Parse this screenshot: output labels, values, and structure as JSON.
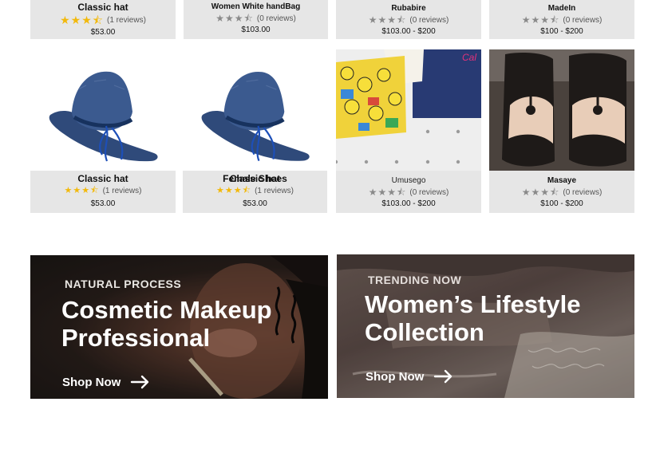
{
  "colors": {
    "card_bg": "#e6e6e6",
    "star_gold": "#f2b90c",
    "star_gray": "#8a8a8a",
    "text": "#111111"
  },
  "top_row": [
    {
      "name": "Classic hat",
      "reviews": "(1 reviews)",
      "price": "$53.00",
      "rating": 3.5,
      "star_color": "gold"
    },
    {
      "name": "Women White handBag",
      "reviews": "(0 reviews)",
      "price": "$103.00",
      "rating": 3.5,
      "star_color": "gray"
    },
    {
      "name": "Rubabire",
      "reviews": "(0 reviews)",
      "price": "$103.00 - $200",
      "rating": 3.5,
      "star_color": "gray"
    },
    {
      "name": "MadeIn",
      "reviews": "(0 reviews)",
      "price": "$100 - $200",
      "rating": 3.5,
      "star_color": "gray"
    }
  ],
  "products": [
    {
      "name": "Classic hat",
      "reviews": "(1 reviews)",
      "price": "$53.00",
      "rating": 3.5,
      "star_color": "gold",
      "image": "blue-hat"
    },
    {
      "name": "Classic hat",
      "name_overlap": "Female Shoes",
      "reviews": "(1 reviews)",
      "price": "$53.00",
      "rating": 3.5,
      "star_color": "gold",
      "image": "blue-hat"
    },
    {
      "name": "Umusego",
      "reviews": "(0 reviews)",
      "price": "$103.00 - $200",
      "rating": 3.5,
      "star_color": "gray",
      "image": "cartoon-pillow"
    },
    {
      "name": "Masaye",
      "reviews": "(0 reviews)",
      "price": "$100 - $200",
      "rating": 3.5,
      "star_color": "gray",
      "image": "leather-sandals"
    }
  ],
  "banners": [
    {
      "eyebrow": "NATURAL PROCESS",
      "headline_line1": "Cosmetic Makeup",
      "headline_line2": "Professional",
      "cta": "Shop Now",
      "icon": "arrow-right-icon"
    },
    {
      "eyebrow": "TRENDING NOW",
      "headline_line1": "Women’s Lifestyle",
      "headline_line2": "Collection",
      "cta": "Shop Now",
      "icon": "arrow-right-icon"
    }
  ]
}
